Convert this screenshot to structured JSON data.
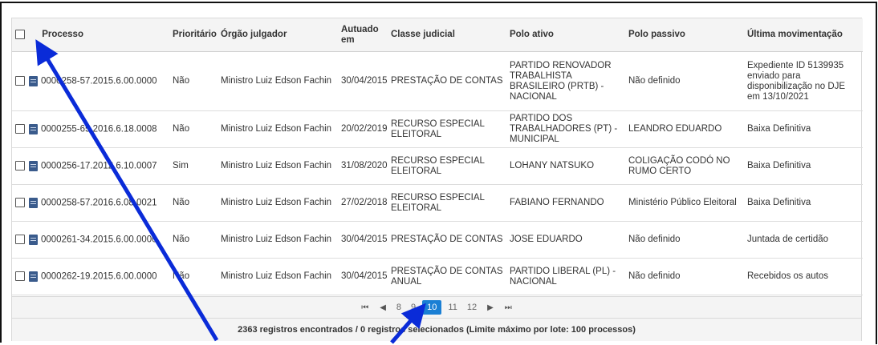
{
  "table": {
    "headers": {
      "processo": "Processo",
      "prioritario": "Prioritário",
      "orgao": "Órgão julgador",
      "autuado": "Autuado em",
      "classe": "Classe judicial",
      "polo_ativo": "Polo ativo",
      "polo_passivo": "Polo passivo",
      "ultima": "Última movimentação"
    },
    "rows": [
      {
        "processo": "0000258-57.2015.6.00.0000",
        "prioritario": "Não",
        "orgao": "Ministro Luiz Edson Fachin",
        "autuado": "30/04/2015",
        "classe": "PRESTAÇÃO DE CONTAS",
        "polo_ativo": "PARTIDO RENOVADOR TRABALHISTA BRASILEIRO (PRTB) - NACIONAL",
        "polo_passivo": "Não definido",
        "ultima": "Expediente ID 5139935 enviado para disponibilização no DJE em 13/10/2021"
      },
      {
        "processo": "0000255-65.2016.6.18.0008",
        "prioritario": "Não",
        "orgao": "Ministro Luiz Edson Fachin",
        "autuado": "20/02/2019",
        "classe": "RECURSO ESPECIAL ELEITORAL",
        "polo_ativo": "PARTIDO DOS TRABALHADORES (PT) - MUNICIPAL",
        "polo_passivo": "LEANDRO EDUARDO",
        "ultima": "Baixa Definitiva"
      },
      {
        "processo": "0000256-17.2012.6.10.0007",
        "prioritario": "Sim",
        "orgao": "Ministro Luiz Edson Fachin",
        "autuado": "31/08/2020",
        "classe": "RECURSO ESPECIAL ELEITORAL",
        "polo_ativo": "LOHANY NATSUKO",
        "polo_passivo": "COLIGAÇÃO CODÓ NO RUMO CERTO",
        "ultima": "Baixa Definitiva"
      },
      {
        "processo": "0000258-57.2016.6.08.0021",
        "prioritario": "Não",
        "orgao": "Ministro Luiz Edson Fachin",
        "autuado": "27/02/2018",
        "classe": "RECURSO ESPECIAL ELEITORAL",
        "polo_ativo": "FABIANO FERNANDO",
        "polo_passivo": "Ministério Público Eleitoral",
        "ultima": "Baixa Definitiva"
      },
      {
        "processo": "0000261-34.2015.6.00.0000",
        "prioritario": "Não",
        "orgao": "Ministro Luiz Edson Fachin",
        "autuado": "30/04/2015",
        "classe": "PRESTAÇÃO DE CONTAS",
        "polo_ativo": "JOSE EDUARDO",
        "polo_passivo": "Não definido",
        "ultima": "Juntada de certidão"
      },
      {
        "processo": "0000262-19.2015.6.00.0000",
        "prioritario": "Não",
        "orgao": "Ministro Luiz Edson Fachin",
        "autuado": "30/04/2015",
        "classe": "PRESTAÇÃO DE CONTAS ANUAL",
        "polo_ativo": "PARTIDO LIBERAL (PL) - NACIONAL",
        "polo_passivo": "Não definido",
        "ultima": "Recebidos os autos"
      }
    ]
  },
  "pagination": {
    "first": "⏮",
    "prev": "◀",
    "pages": [
      "8",
      "9",
      "10",
      "11",
      "12"
    ],
    "current": "10",
    "next": "▶",
    "last": "⏭"
  },
  "status": "2363 registros encontrados / 0 registros selecionados (Limite máximo por lote: 100 processos)",
  "colors": {
    "accent": "#1a7fd4",
    "arrow": "#0a2bd8",
    "doc_icon": "#3a5b8c"
  }
}
